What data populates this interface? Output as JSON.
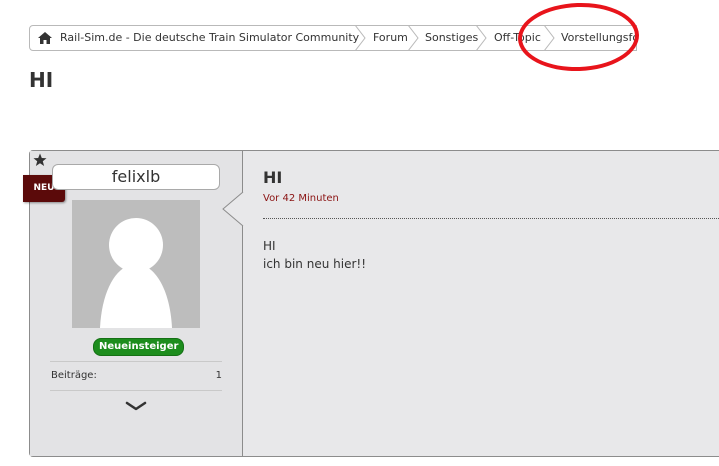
{
  "breadcrumb": {
    "items": [
      {
        "label": "Rail-Sim.de - Die deutsche Train Simulator Community",
        "icon": "home-icon"
      },
      {
        "label": "Forum"
      },
      {
        "label": "Sonstiges"
      },
      {
        "label": "Off-Topic"
      },
      {
        "label": "Vorstellungsforum"
      }
    ]
  },
  "page": {
    "title": "HI"
  },
  "post": {
    "badge_new": "NEU",
    "author": {
      "username": "felixlb",
      "rank": "Neueinsteiger",
      "stats": {
        "posts_label": "Beiträge:",
        "posts_value": "1"
      }
    },
    "title": "HI",
    "time": "Vor 42 Minuten",
    "body_lines": [
      "HI",
      "ich bin neu hier!!"
    ]
  },
  "colors": {
    "badge_new_bg": "#5b0a0a",
    "rank_bg": "#1d8d1d",
    "time_color": "#8b1414",
    "annotation": "#e8141b"
  }
}
